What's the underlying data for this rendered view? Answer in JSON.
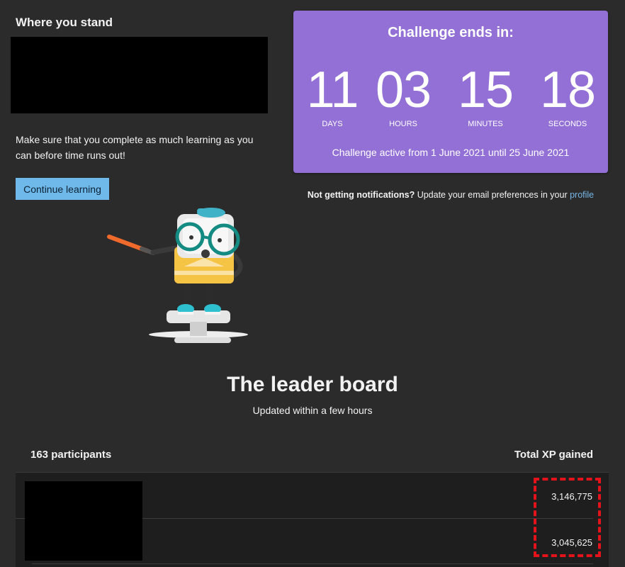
{
  "standing": {
    "title": "Where you stand",
    "message": "Make sure that you complete as much learning as you can before time runs out!",
    "continue_label": "Continue learning"
  },
  "countdown": {
    "title": "Challenge ends in:",
    "units": [
      {
        "value": "11",
        "label": "DAYS"
      },
      {
        "value": "03",
        "label": "HOURS"
      },
      {
        "value": "15",
        "label": "MINUTES"
      },
      {
        "value": "18",
        "label": "SECONDS"
      }
    ],
    "active_range": "Challenge active from 1 June 2021 until 25 June 2021",
    "accent_color": "#9370d6"
  },
  "notifications": {
    "bold": "Not getting notifications?",
    "text": " Update your email preferences in your ",
    "link": "profile"
  },
  "leaderboard": {
    "title": "The leader board",
    "subtitle": "Updated within a few hours",
    "participants": "163 participants",
    "xp_header": "Total XP gained",
    "rows": [
      {
        "xp": "3,146,775"
      },
      {
        "xp": "3,045,625"
      }
    ],
    "highlight_color": "#e3121b"
  }
}
